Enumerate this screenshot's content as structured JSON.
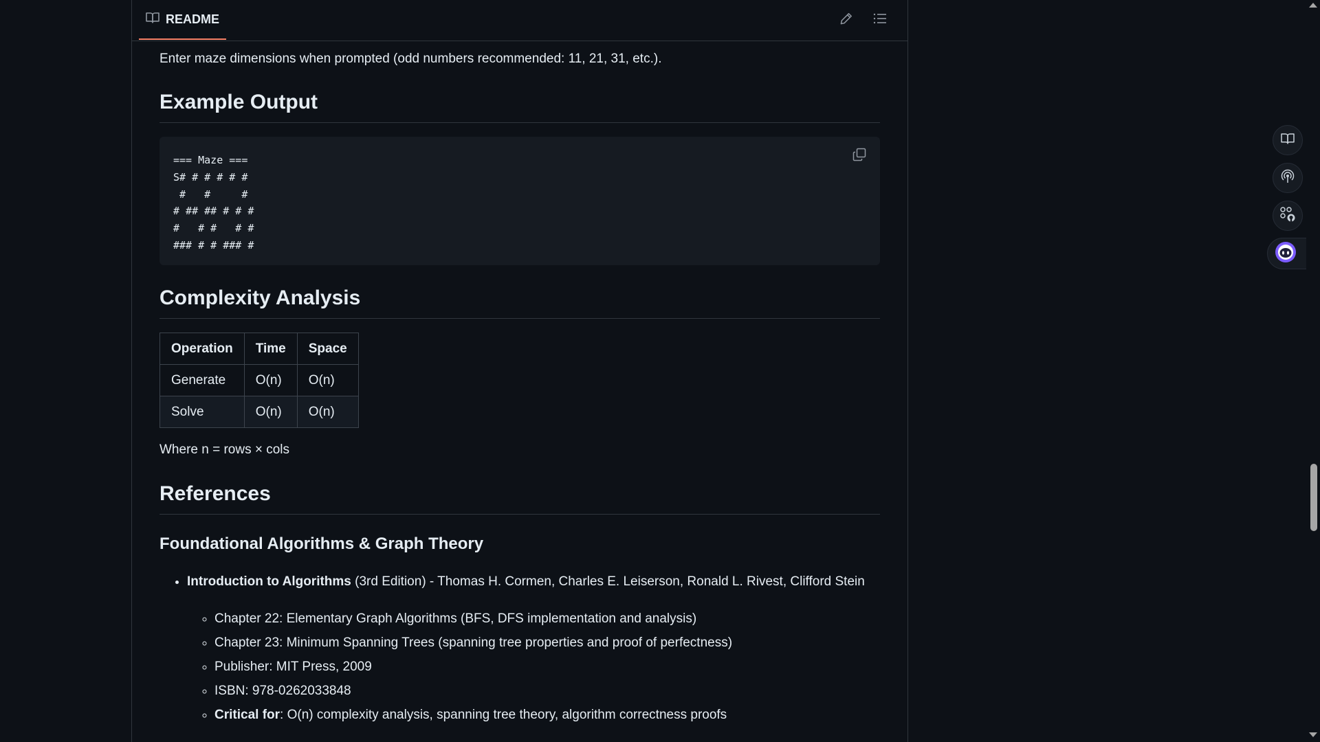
{
  "readme": {
    "tab_label": "README",
    "intro": "Enter maze dimensions when prompted (odd numbers recommended: 11, 21, 31, etc.).",
    "example_heading": "Example Output",
    "code": "=== Maze ===\nS# # # # # #\n #   #     #\n# ## ## # # #\n#   # #   # #\n### # # ### #",
    "complexity_heading": "Complexity Analysis",
    "table": {
      "headers": [
        "Operation",
        "Time",
        "Space"
      ],
      "rows": [
        [
          "Generate",
          "O(n)",
          "O(n)"
        ],
        [
          "Solve",
          "O(n)",
          "O(n)"
        ]
      ]
    },
    "where_note": "Where n = rows × cols",
    "references_heading": "References",
    "foundational_heading": "Foundational Algorithms & Graph Theory",
    "ref_item": {
      "title": "Introduction to Algorithms",
      "rest": " (3rd Edition) - Thomas H. Cormen, Charles E. Leiserson, Ronald L. Rivest, Clifford Stein",
      "sub_items": [
        "Chapter 22: Elementary Graph Algorithms (BFS, DFS implementation and analysis)",
        "Chapter 23: Minimum Spanning Trees (spanning tree properties and proof of perfectness)",
        "Publisher: MIT Press, 2009",
        "ISBN: 978-0262033848"
      ],
      "critical_label": "Critical for",
      "critical_text": ": O(n) complexity analysis, spanning tree theory, algorithm correctness proofs"
    }
  },
  "icons": {
    "tab": "book-icon",
    "edit": "pencil-icon",
    "outline": "list-icon",
    "copy": "copy-icon",
    "side_tools": [
      "book-icon",
      "broadcast-icon",
      "apps-github-icon",
      "copilot-icon"
    ]
  },
  "colors": {
    "background": "#0d1117",
    "code_bg": "#161b22",
    "border": "#30363d",
    "tab_underline": "#f78166",
    "text": "#e6edf3",
    "copilot_accent": "#7c5cff"
  }
}
